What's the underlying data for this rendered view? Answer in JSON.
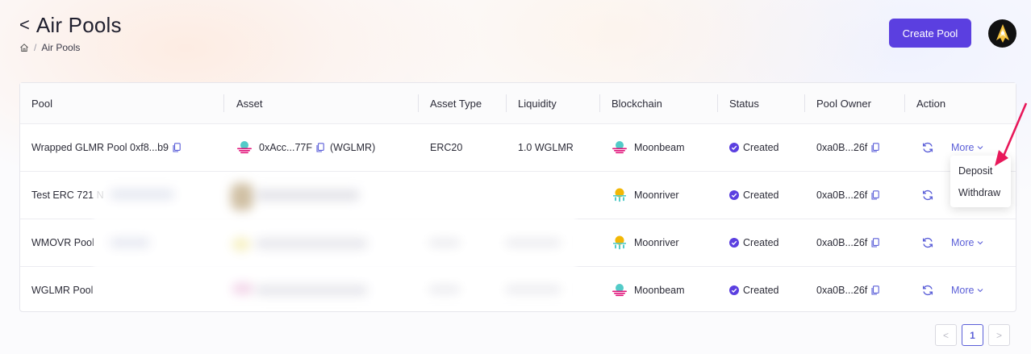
{
  "header": {
    "back_glyph": "<",
    "title": "Air Pools",
    "breadcrumb_page": "Air Pools",
    "breadcrumb_sep": "/"
  },
  "toolbar": {
    "create_label": "Create Pool"
  },
  "table": {
    "columns": [
      "Pool",
      "Asset",
      "Asset Type",
      "Liquidity",
      "Blockchain",
      "Status",
      "Pool Owner",
      "Action"
    ],
    "rows": [
      {
        "pool": "Wrapped GLMR Pool 0xf8...b9",
        "asset": "0xAcc...77F",
        "asset_symbol": "(WGLMR)",
        "asset_type": "ERC20",
        "liquidity": "1.0 WGLMR",
        "chain": "Moonbeam",
        "status": "Created",
        "owner": "0xa0B...26f",
        "action": "More"
      },
      {
        "pool": "Test ERC 721 N",
        "asset": "",
        "asset_symbol": "",
        "asset_type": "",
        "liquidity": "",
        "chain": "Moonriver",
        "status": "Created",
        "owner": "0xa0B...26f",
        "action": ""
      },
      {
        "pool": "WMOVR Pool",
        "asset": "",
        "asset_symbol": "",
        "asset_type": "",
        "liquidity": "",
        "chain": "Moonriver",
        "status": "Created",
        "owner": "0xa0B...26f",
        "action": "More"
      },
      {
        "pool": "WGLMR Pool",
        "asset": "",
        "asset_symbol": "",
        "asset_type": "",
        "liquidity": "",
        "chain": "Moonbeam",
        "status": "Created",
        "owner": "0xa0B...26f",
        "action": "More"
      }
    ]
  },
  "dropdown": {
    "items": [
      "Deposit",
      "Withdraw"
    ]
  },
  "pagination": {
    "prev": "<",
    "current": "1",
    "next": ">"
  },
  "colors": {
    "accent": "#5b3fe0",
    "link": "#5b5fd8",
    "status": "#5b3fe0",
    "arrow": "#e8185a"
  },
  "icons": [
    "back-icon",
    "home-icon",
    "copy-icon",
    "moonbeam-icon",
    "moonriver-icon",
    "check-circle-icon",
    "refresh-icon",
    "chevron-down-icon",
    "avatar-logo-icon"
  ]
}
